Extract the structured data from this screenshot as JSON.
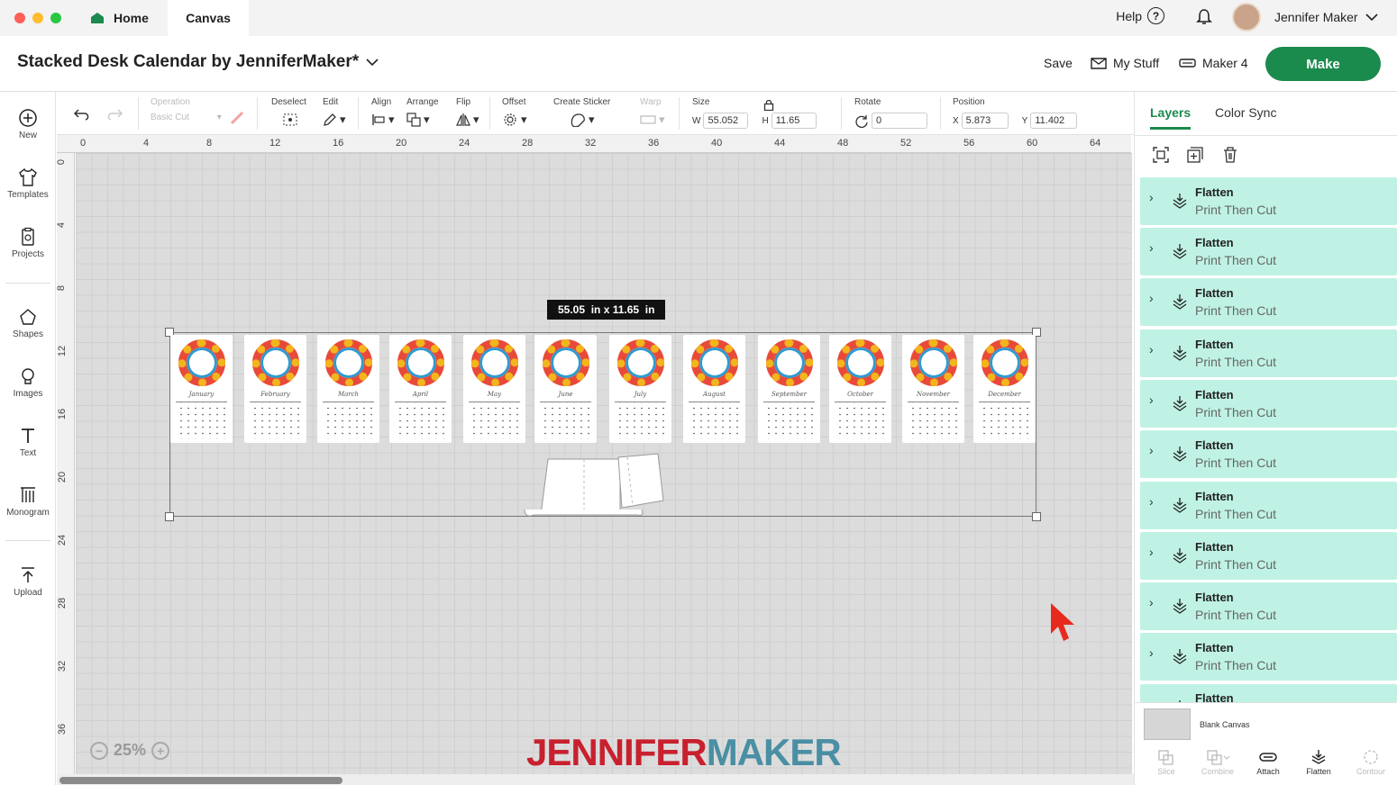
{
  "titlebar": {
    "home_label": "Home",
    "canvas_label": "Canvas",
    "help_label": "Help",
    "help_glyph": "?",
    "user_name": "Jennifer Maker"
  },
  "header": {
    "project_title": "Stacked Desk Calendar by JenniferMaker*",
    "save_label": "Save",
    "mystuff_label": "My Stuff",
    "machine_label": "Maker 4",
    "make_label": "Make"
  },
  "sidebar": {
    "items": [
      {
        "label": "New",
        "icon": "plus-circle-icon"
      },
      {
        "label": "Templates",
        "icon": "shirt-icon"
      },
      {
        "label": "Projects",
        "icon": "clipboard-icon"
      },
      {
        "label": "Shapes",
        "icon": "shapes-icon"
      },
      {
        "label": "Images",
        "icon": "bulb-icon"
      },
      {
        "label": "Text",
        "icon": "text-icon"
      },
      {
        "label": "Monogram",
        "icon": "monogram-icon"
      },
      {
        "label": "Upload",
        "icon": "upload-icon"
      }
    ]
  },
  "toolbar": {
    "operation_label": "Operation",
    "operation_value": "Basic Cut",
    "deselect_label": "Deselect",
    "edit_label": "Edit",
    "align_label": "Align",
    "arrange_label": "Arrange",
    "flip_label": "Flip",
    "offset_label": "Offset",
    "sticker_label": "Create Sticker",
    "warp_label": "Warp",
    "size_label": "Size",
    "w_label": "W",
    "w_value": "55.052",
    "h_label": "H",
    "h_value": "11.65",
    "rotate_label": "Rotate",
    "rotate_value": "0",
    "position_label": "Position",
    "x_label": "X",
    "x_value": "5.873",
    "y_label": "Y",
    "y_value": "11.402"
  },
  "ruler": {
    "h_ticks": [
      "0",
      "4",
      "8",
      "12",
      "16",
      "20",
      "24",
      "28",
      "32",
      "36",
      "40",
      "44",
      "48",
      "52",
      "56",
      "60",
      "64"
    ],
    "v_ticks": [
      "0",
      "4",
      "8",
      "12",
      "16",
      "20",
      "24",
      "28",
      "32",
      "36"
    ]
  },
  "canvas": {
    "dimensions_label": "55.05  in x 11.65  in",
    "zoom_label": "25%",
    "zoom_minus": "−",
    "zoom_plus": "+",
    "logo_part1": "JENNIFER",
    "logo_part2": "MAKER",
    "months": [
      "January",
      "February",
      "March",
      "April",
      "May",
      "June",
      "July",
      "August",
      "September",
      "October",
      "November",
      "December"
    ]
  },
  "layers_panel": {
    "tab_layers": "Layers",
    "tab_colorsync": "Color Sync",
    "layers": [
      {
        "name": "Flatten",
        "type": "Print Then Cut"
      },
      {
        "name": "Flatten",
        "type": "Print Then Cut"
      },
      {
        "name": "Flatten",
        "type": "Print Then Cut"
      },
      {
        "name": "Flatten",
        "type": "Print Then Cut"
      },
      {
        "name": "Flatten",
        "type": "Print Then Cut"
      },
      {
        "name": "Flatten",
        "type": "Print Then Cut"
      },
      {
        "name": "Flatten",
        "type": "Print Then Cut"
      },
      {
        "name": "Flatten",
        "type": "Print Then Cut"
      },
      {
        "name": "Flatten",
        "type": "Print Then Cut"
      },
      {
        "name": "Flatten",
        "type": "Print Then Cut"
      },
      {
        "name": "Flatten",
        "type": ""
      }
    ],
    "blank_canvas_label": "Blank Canvas",
    "bottom_tools": [
      "Slice",
      "Combine",
      "Attach",
      "Flatten",
      "Contour"
    ]
  },
  "colors": {
    "accent": "#1b8a4d",
    "layer_bg": "#bff2e4",
    "logo_red": "#c8202e",
    "logo_teal": "#4a8fa3"
  }
}
